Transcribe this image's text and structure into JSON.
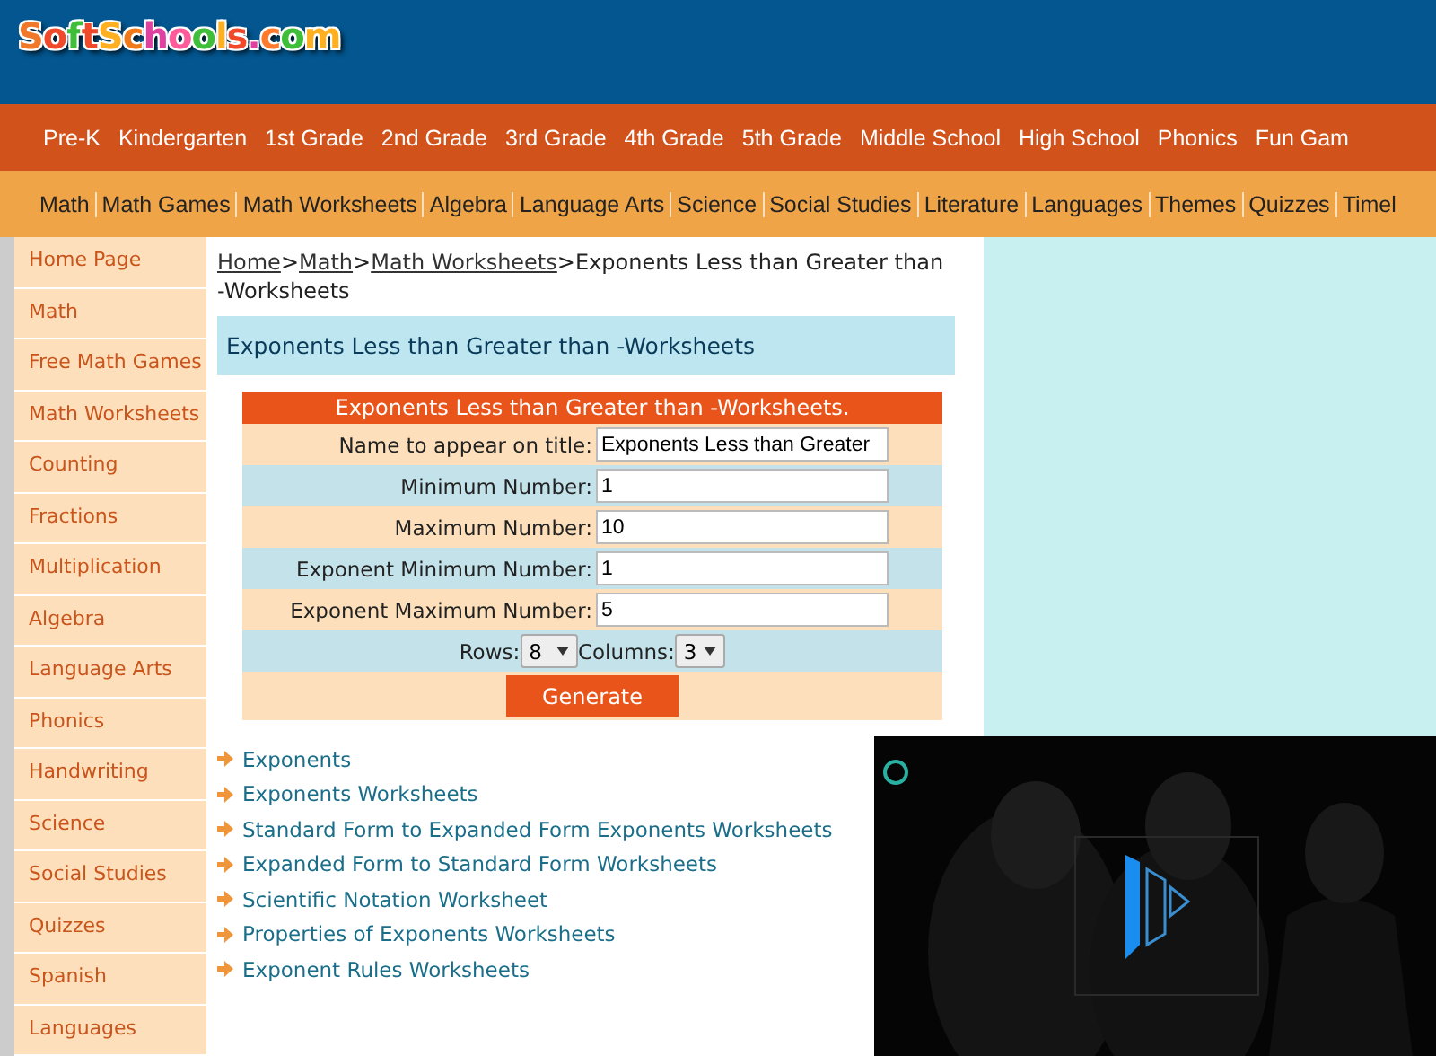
{
  "logo": "SoftSchools.com",
  "nav": [
    "Pre-K",
    "Kindergarten",
    "1st Grade",
    "2nd Grade",
    "3rd Grade",
    "4th Grade",
    "5th Grade",
    "Middle School",
    "High School",
    "Phonics",
    "Fun Gam"
  ],
  "subnav": [
    "Math",
    "Math Games",
    "Math Worksheets",
    "Algebra",
    "Language Arts",
    "Science",
    "Social Studies",
    "Literature",
    "Languages",
    "Themes",
    "Quizzes",
    "Timel"
  ],
  "sidebar": {
    "items": [
      "Home Page",
      "Math",
      "Free Math Games",
      "Math Worksheets",
      "Counting",
      "Fractions",
      "Multiplication",
      "Algebra",
      "Language Arts",
      "Phonics",
      "Handwriting",
      "Science",
      "Social Studies",
      "Quizzes",
      "Spanish",
      "Languages"
    ]
  },
  "breadcrumb": [
    {
      "kind": "link",
      "text": "Home"
    },
    {
      "kind": "separator",
      "text": ">"
    },
    {
      "kind": "link",
      "text": "Math"
    },
    {
      "kind": "separator",
      "text": ">"
    },
    {
      "kind": "link",
      "text": "Math Worksheets"
    },
    {
      "kind": "separator",
      "text": ">"
    },
    {
      "kind": "current",
      "text": "Exponents Less than Greater than -Worksheets"
    }
  ],
  "page_title": "Exponents Less than Greater than -Worksheets",
  "form": {
    "header": "Exponents Less than Greater than -Worksheets.",
    "fields": [
      {
        "label": "Name to appear on title:",
        "value": "Exponents Less than Greater"
      },
      {
        "label": "Minimum Number:",
        "value": "1"
      },
      {
        "label": "Maximum Number:",
        "value": "10"
      },
      {
        "label": "Exponent Minimum Number:",
        "value": "1"
      },
      {
        "label": "Exponent Maximum Number:",
        "value": "5"
      }
    ],
    "rows_label": "Rows:",
    "rows_value": "8",
    "columns_label": "Columns:",
    "columns_value": "3",
    "button": "Generate"
  },
  "links": [
    "Exponents",
    "Exponents Worksheets",
    "Standard Form to Expanded Form Exponents Worksheets",
    "Expanded Form to Standard Form Worksheets",
    "Scientific Notation Worksheet",
    "Properties of Exponents Worksheets",
    "Exponent Rules Worksheets"
  ],
  "video": {
    "kind": "picture"
  }
}
